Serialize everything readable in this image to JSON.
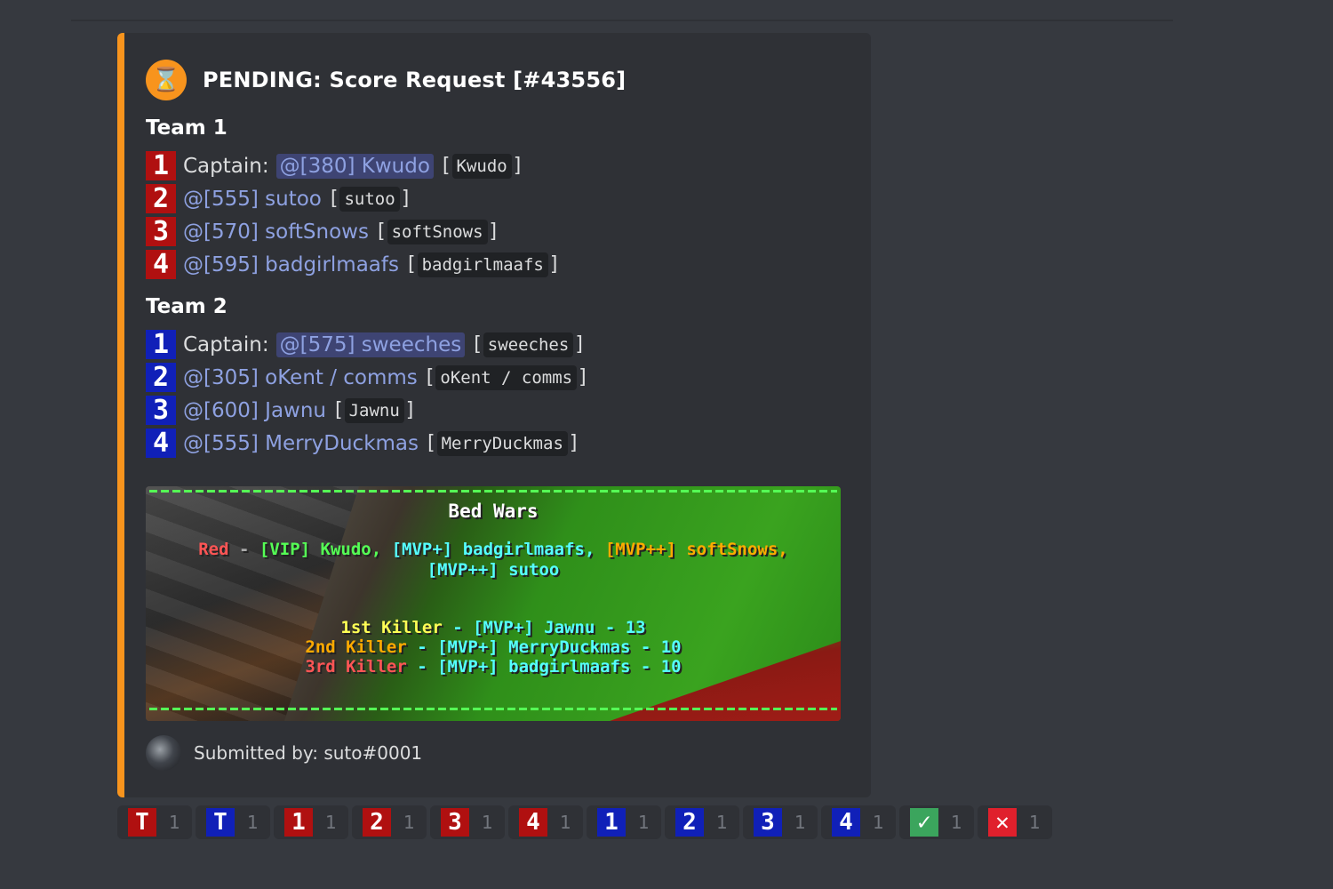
{
  "embed": {
    "accent_color": "#f8941d",
    "status_icon": "hourglass-icon",
    "title": "PENDING: Score Request [#43556]",
    "teams": [
      {
        "title": "Team 1",
        "badge_color": "#b01010",
        "players": [
          {
            "num": "1",
            "captain_label": "Captain:",
            "mention": "@[380] Kwudo",
            "ign": "Kwudo"
          },
          {
            "num": "2",
            "mention": "@[555] sutoo",
            "ign": "sutoo"
          },
          {
            "num": "3",
            "mention": "@[570] softSnows",
            "ign": "softSnows"
          },
          {
            "num": "4",
            "mention": "@[595] badgirlmaafs",
            "ign": "badgirlmaafs"
          }
        ]
      },
      {
        "title": "Team 2",
        "badge_color": "#1020b8",
        "players": [
          {
            "num": "1",
            "captain_label": "Captain:",
            "mention": "@[575] sweeches",
            "ign": "sweeches"
          },
          {
            "num": "2",
            "mention": "@[305] oKent / comms",
            "ign": "oKent / comms"
          },
          {
            "num": "3",
            "mention": "@[600] Jawnu",
            "ign": "Jawnu"
          },
          {
            "num": "4",
            "mention": "@[555] MerryDuckmas",
            "ign": "MerryDuckmas"
          }
        ]
      }
    ],
    "screenshot": {
      "title": "Bed Wars",
      "line1": {
        "team": "Red",
        "sep": " - ",
        "p1_rank": "[VIP]",
        "p1": " Kwudo, ",
        "p2_rank": "[MVP+]",
        "p2": " badgirlmaafs, ",
        "p3_rank": "[MVP++]",
        "p3": " softSnows,"
      },
      "line2": {
        "p4_rank": "[MVP++]",
        "p4": " sutoo"
      },
      "killers": [
        {
          "label": "1st Killer",
          "rest": " - [MVP+] Jawnu - 13"
        },
        {
          "label": "2nd Killer",
          "rest": " - [MVP+] MerryDuckmas - 10"
        },
        {
          "label": "3rd Killer",
          "rest": " - [MVP+] badgirlmaafs - 10"
        }
      ]
    },
    "footer": {
      "text": "Submitted by: suto#0001"
    }
  },
  "reactions": [
    {
      "emoji": "T",
      "color": "#b01010",
      "count": "1"
    },
    {
      "emoji": "T",
      "color": "#1020b8",
      "count": "1"
    },
    {
      "emoji": "1",
      "color": "#b01010",
      "count": "1"
    },
    {
      "emoji": "2",
      "color": "#b01010",
      "count": "1"
    },
    {
      "emoji": "3",
      "color": "#b01010",
      "count": "1"
    },
    {
      "emoji": "4",
      "color": "#b01010",
      "count": "1"
    },
    {
      "emoji": "1",
      "color": "#1020b8",
      "count": "1"
    },
    {
      "emoji": "2",
      "color": "#1020b8",
      "count": "1"
    },
    {
      "emoji": "3",
      "color": "#1020b8",
      "count": "1"
    },
    {
      "emoji": "4",
      "color": "#1020b8",
      "count": "1"
    },
    {
      "emoji": "✓",
      "color": "#3ba55d",
      "count": "1"
    },
    {
      "emoji": "✕",
      "color": "#e0202c",
      "count": "1"
    }
  ]
}
